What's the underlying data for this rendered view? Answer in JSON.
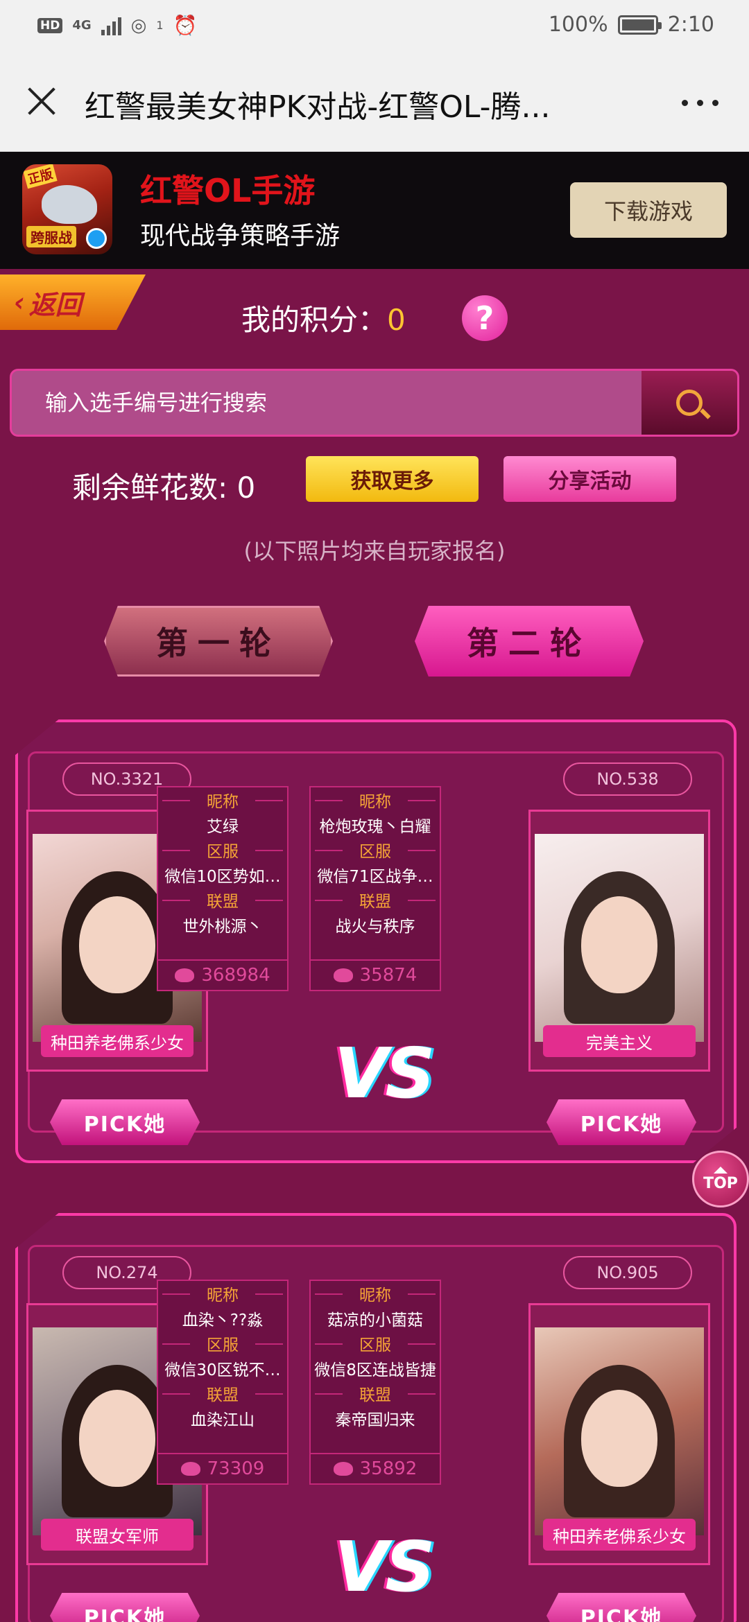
{
  "status_bar": {
    "hd": "HD",
    "network": "4G",
    "sim": "1",
    "battery": "100%",
    "time": "2:10"
  },
  "browser": {
    "title": "红警最美女神PK对战-红警OL-腾..."
  },
  "banner": {
    "game_name": "红警OL手游",
    "game_sub": "现代战争策略手游",
    "download_label": "下载游戏",
    "icon_ribbon": "正版",
    "icon_tag": "跨服战"
  },
  "page": {
    "back_label": "返回",
    "score_label": "我的积分：",
    "score_value": "0",
    "help_label": "?",
    "search_placeholder": "输入选手编号进行搜索",
    "flowers_text": "剩余鲜花数: 0",
    "get_more_label": "获取更多",
    "share_label": "分享活动",
    "note": "(以下照片均来自玩家报名)",
    "round1": "第一轮",
    "round2": "第二轮",
    "top_label": "TOP"
  },
  "labels": {
    "nickname": "昵称",
    "server": "区服",
    "alliance": "联盟",
    "pick": "PICK她",
    "vs": "VS"
  },
  "matches": [
    {
      "left": {
        "no": "NO.3321",
        "tag": "种田养老佛系少女",
        "nickname": "艾绿",
        "server": "微信10区势如…",
        "alliance": "世外桃源丶",
        "votes": "368984"
      },
      "right": {
        "no": "NO.538",
        "tag": "完美主义",
        "nickname": "枪炮玫瑰丶白耀",
        "server": "微信71区战争…",
        "alliance": "战火与秩序",
        "votes": "35874"
      }
    },
    {
      "left": {
        "no": "NO.274",
        "tag": "联盟女军师",
        "nickname": "血染丶??淼",
        "server": "微信30区锐不…",
        "alliance": "血染江山",
        "votes": "73309"
      },
      "right": {
        "no": "NO.905",
        "tag": "种田养老佛系少女",
        "nickname": "菇凉的小菌菇",
        "server": "微信8区连战皆捷",
        "alliance": "秦帝国归来",
        "votes": "35892"
      }
    }
  ],
  "colors": {
    "page_bg": "#7a1448",
    "accent_pink": "#ff3aa8",
    "gold": "#ffc531",
    "brand_red": "#e1141b"
  }
}
